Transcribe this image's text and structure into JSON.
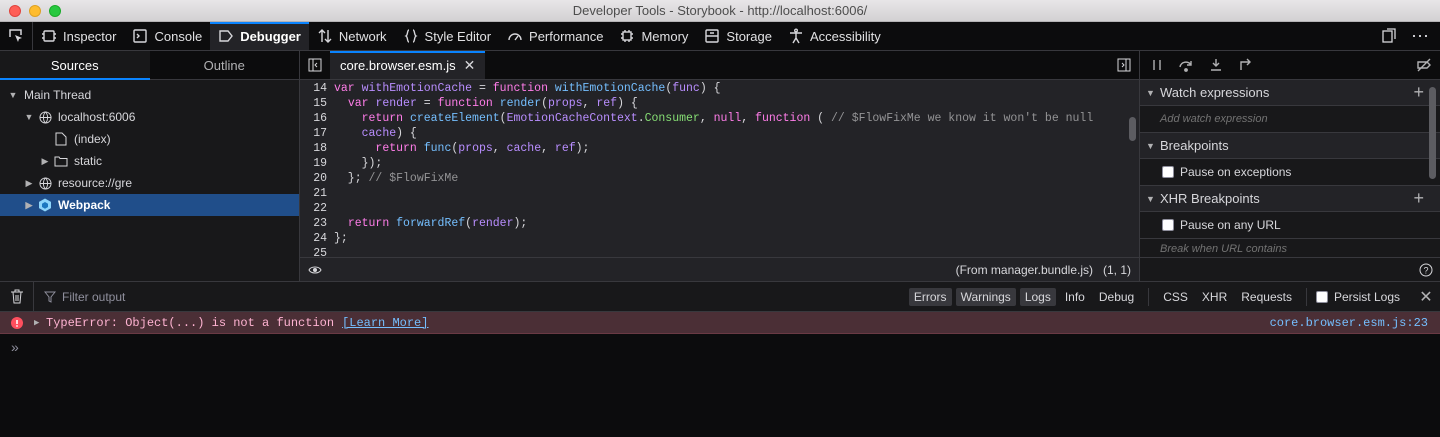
{
  "window": {
    "title": "Developer Tools - Storybook - http://localhost:6006/"
  },
  "toolbox": {
    "tabs": [
      {
        "label": "Inspector",
        "icon": "inspector-icon"
      },
      {
        "label": "Console",
        "icon": "console-icon"
      },
      {
        "label": "Debugger",
        "icon": "debugger-icon",
        "selected": true
      },
      {
        "label": "Network",
        "icon": "network-icon"
      },
      {
        "label": "Style Editor",
        "icon": "style-editor-icon"
      },
      {
        "label": "Performance",
        "icon": "performance-icon"
      },
      {
        "label": "Memory",
        "icon": "memory-icon"
      },
      {
        "label": "Storage",
        "icon": "storage-icon"
      },
      {
        "label": "Accessibility",
        "icon": "accessibility-icon"
      }
    ]
  },
  "sources": {
    "tabs": [
      "Sources",
      "Outline"
    ],
    "tree": [
      {
        "label": "Main Thread",
        "arrow": "down",
        "icon": "",
        "level": 0
      },
      {
        "label": "localhost:6006",
        "arrow": "down",
        "icon": "globe-icon",
        "level": 1
      },
      {
        "label": "(index)",
        "arrow": "",
        "icon": "file-icon",
        "level": 2
      },
      {
        "label": "static",
        "arrow": "right",
        "icon": "folder-icon",
        "level": 2
      },
      {
        "label": "resource://gre",
        "arrow": "right",
        "icon": "globe-icon",
        "level": 1
      },
      {
        "label": "Webpack",
        "arrow": "right",
        "icon": "webpack-icon",
        "level": 1,
        "selected": true
      }
    ]
  },
  "editor": {
    "tab": "core.browser.esm.js",
    "footer": {
      "from": "(From manager.bundle.js)",
      "cursor": "(1, 1)"
    },
    "lines": [
      {
        "n": "14",
        "html": "<span class=k>var</span> <span class=p>withEmotionCache</span> = <span class=k>function</span> <span class=f>withEmotionCache</span>(<span class=p>func</span>) {"
      },
      {
        "n": "15",
        "html": "  <span class=k>var</span> <span class=p>render</span> = <span class=k>function</span> <span class=f>render</span>(<span class=p>props</span>, <span class=p>ref</span>) {"
      },
      {
        "n": "16",
        "html": "    <span class=k>return</span> <span class=f>createElement</span>(<span class=p>EmotionCacheContext</span>.<span class=s>Consumer</span>, <span class=k>null</span>, <span class=k>function</span> ( <span class=c>// $FlowFixMe we know it won't be null</span>"
      },
      {
        "n": "17",
        "html": "    <span class=p>cache</span>) {"
      },
      {
        "n": "18",
        "html": "      <span class=k>return</span> <span class=f>func</span>(<span class=p>props</span>, <span class=p>cache</span>, <span class=p>ref</span>);"
      },
      {
        "n": "19",
        "html": "    });"
      },
      {
        "n": "20",
        "html": "  }; <span class=c>// $FlowFixMe</span>"
      },
      {
        "n": "21",
        "html": ""
      },
      {
        "n": "22",
        "html": ""
      },
      {
        "n": "23",
        "html": "  <span class=k>return</span> <span class=f>forwardRef</span>(<span class=p>render</span>);"
      },
      {
        "n": "24",
        "html": "};"
      },
      {
        "n": "25",
        "html": ""
      }
    ]
  },
  "debug": {
    "watch": "Watch expressions",
    "watch_placeholder": "Add watch expression",
    "breakpoints": "Breakpoints",
    "pause_exceptions": "Pause on exceptions",
    "xhr": "XHR Breakpoints",
    "pause_url": "Pause on any URL",
    "url_contains": "Break when URL contains"
  },
  "console": {
    "filter_placeholder": "Filter output",
    "levels": [
      {
        "label": "Errors",
        "on": true
      },
      {
        "label": "Warnings",
        "on": true
      },
      {
        "label": "Logs",
        "on": true
      },
      {
        "label": "Info",
        "on": false
      },
      {
        "label": "Debug",
        "on": false
      }
    ],
    "types": [
      "CSS",
      "XHR",
      "Requests"
    ],
    "persist": "Persist Logs",
    "error": {
      "text": "TypeError: Object(...) is not a function",
      "link": "[Learn More]",
      "source": "core.browser.esm.js:23"
    }
  }
}
